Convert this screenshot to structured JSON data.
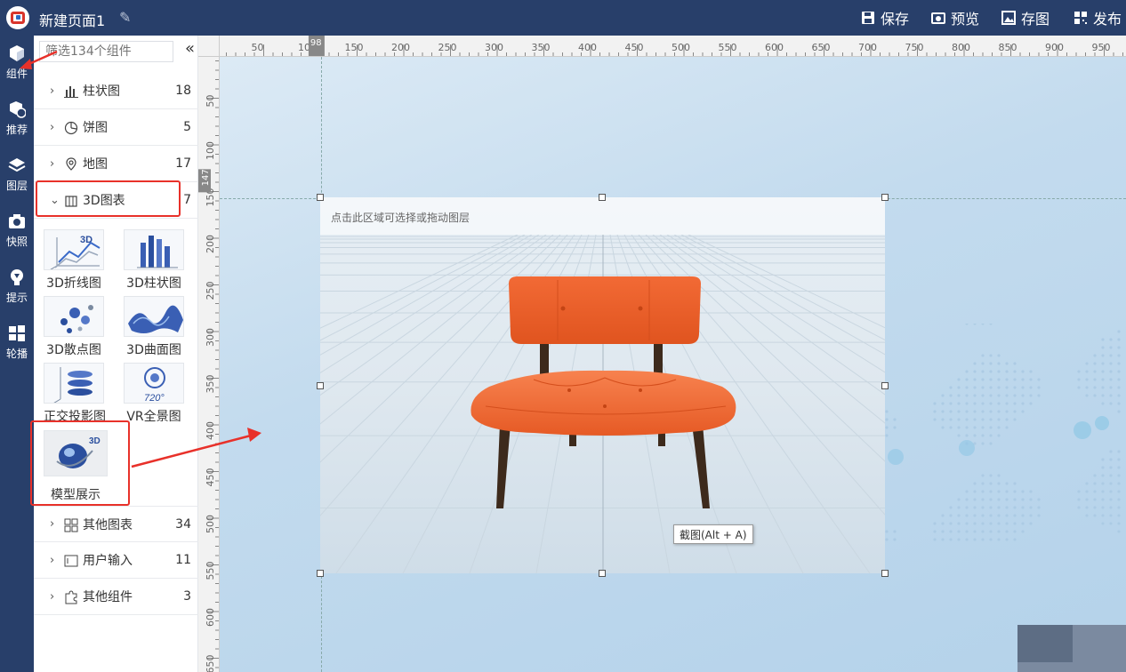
{
  "header": {
    "title": "新建页面1",
    "buttons": [
      {
        "label": "保存",
        "icon": "save-icon"
      },
      {
        "label": "预览",
        "icon": "preview-icon"
      },
      {
        "label": "存图",
        "icon": "image-icon"
      },
      {
        "label": "发布",
        "icon": "qrcode-icon"
      }
    ]
  },
  "rail": {
    "items": [
      {
        "label": "组件",
        "icon": "cube-icon"
      },
      {
        "label": "推荐",
        "icon": "ai-cube-icon"
      },
      {
        "label": "图层",
        "icon": "layers-icon"
      },
      {
        "label": "快照",
        "icon": "camera-icon"
      },
      {
        "label": "提示",
        "icon": "bulb-icon"
      },
      {
        "label": "轮播",
        "icon": "grid-icon"
      }
    ]
  },
  "panel": {
    "search_placeholder": "筛选134个组件",
    "collapse_glyph": "«",
    "categories": [
      {
        "name": "柱状图",
        "count": "18",
        "icon": "bar-chart-icon"
      },
      {
        "name": "饼图",
        "count": "5",
        "icon": "pie-chart-icon"
      },
      {
        "name": "地图",
        "count": "17",
        "icon": "map-icon"
      },
      {
        "name": "3D图表",
        "count": "7",
        "icon": "3d-cube-icon"
      },
      {
        "name": "其他图表",
        "count": "34",
        "icon": "other-chart-icon"
      },
      {
        "name": "用户输入",
        "count": "11",
        "icon": "input-icon"
      },
      {
        "name": "其他组件",
        "count": "3",
        "icon": "puzzle-icon"
      }
    ],
    "tiles": [
      {
        "label": "3D折线图"
      },
      {
        "label": "3D柱状图"
      },
      {
        "label": "3D散点图"
      },
      {
        "label": "3D曲面图"
      },
      {
        "label": "正交投影图"
      },
      {
        "label": "VR全景图"
      },
      {
        "label": "模型展示"
      }
    ]
  },
  "ruler": {
    "top_labels": [
      "50",
      "100",
      "150",
      "200",
      "250",
      "300",
      "350",
      "400",
      "450",
      "500",
      "550",
      "600",
      "650",
      "700",
      "750",
      "800",
      "850",
      "900",
      "950"
    ],
    "left_labels": [
      "50",
      "100",
      "150",
      "200",
      "250",
      "300",
      "350",
      "400",
      "450",
      "500",
      "550",
      "600",
      "650"
    ],
    "top_marker": "98",
    "left_marker": "147"
  },
  "canvas": {
    "stage_hint": "点击此区域可选择或拖动图层",
    "tooltip": "截图(Alt + A)",
    "accent": "#283f6a",
    "chair_color": "#f26a35",
    "annotation_color": "#e8312a"
  }
}
